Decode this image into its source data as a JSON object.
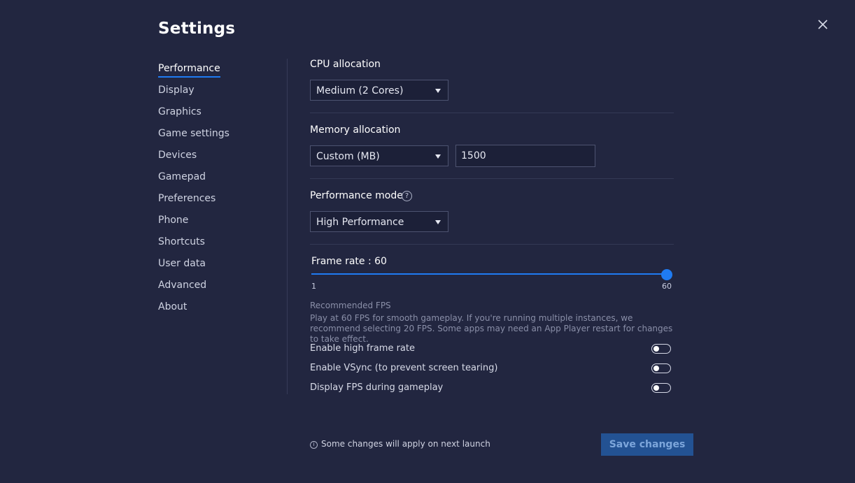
{
  "title": "Settings",
  "nav": [
    {
      "label": "Performance",
      "active": true
    },
    {
      "label": "Display"
    },
    {
      "label": "Graphics"
    },
    {
      "label": "Game settings"
    },
    {
      "label": "Devices"
    },
    {
      "label": "Gamepad"
    },
    {
      "label": "Preferences"
    },
    {
      "label": "Phone"
    },
    {
      "label": "Shortcuts"
    },
    {
      "label": "User data"
    },
    {
      "label": "Advanced"
    },
    {
      "label": "About"
    }
  ],
  "cpu": {
    "label": "CPU allocation",
    "value": "Medium (2 Cores)"
  },
  "memory": {
    "label": "Memory allocation",
    "mode": "Custom (MB)",
    "amount": "1500"
  },
  "performance_mode": {
    "label": "Performance mode",
    "value": "High Performance",
    "help_icon": "?"
  },
  "frame_rate": {
    "label": "Frame rate : 60",
    "min": "1",
    "max": "60",
    "value": 60
  },
  "recommended": {
    "heading": "Recommended FPS",
    "text": "Play at 60 FPS for smooth gameplay. If you're running multiple instances, we recommend selecting 20 FPS. Some apps may need an App Player restart for changes to take effect."
  },
  "toggles": [
    {
      "label": "Enable high frame rate",
      "on": false
    },
    {
      "label": "Enable VSync (to prevent screen tearing)",
      "on": false
    },
    {
      "label": "Display FPS during gameplay",
      "on": false
    }
  ],
  "footer": {
    "note": "Some changes will apply on next launch",
    "info_icon": "i",
    "save_label": "Save changes"
  },
  "colors": {
    "background": "#222640",
    "accent": "#1f7bf2",
    "save_button": "#235293"
  }
}
